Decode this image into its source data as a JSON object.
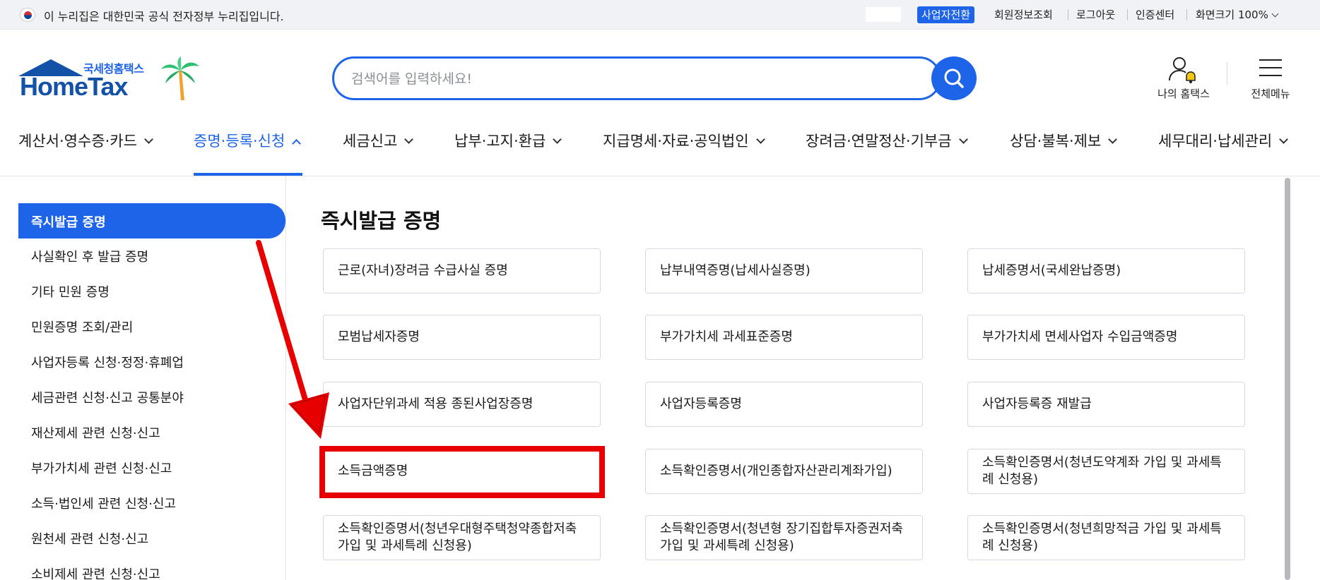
{
  "govbar": {
    "text": "이 누리집은 대한민국 공식 전자정부 누리집입니다.",
    "switch_label": "사업자전환",
    "links": [
      "회원정보조회",
      "로그아웃",
      "인증센터"
    ],
    "zoom_label": "화면크기 100%"
  },
  "header": {
    "logo_kr": "국세청홈택스",
    "logo_en": "HomeTax",
    "search_placeholder": "검색어를 입력하세요!",
    "myhome_label": "나의 홈택스",
    "allmenu_label": "전체메뉴"
  },
  "gnb": {
    "items": [
      {
        "label": "계산서·영수증·카드"
      },
      {
        "label": "증명·등록·신청"
      },
      {
        "label": "세금신고"
      },
      {
        "label": "납부·고지·환급"
      },
      {
        "label": "지급명세·자료·공익법인"
      },
      {
        "label": "장려금·연말정산·기부금"
      },
      {
        "label": "상담·불복·제보"
      },
      {
        "label": "세무대리·납세관리"
      }
    ]
  },
  "sidebar": {
    "items": [
      {
        "label": "즉시발급 증명"
      },
      {
        "label": "사실확인 후 발급 증명"
      },
      {
        "label": "기타 민원 증명"
      },
      {
        "label": "민원증명 조회/관리"
      },
      {
        "label": "사업자등록 신청·정정·휴폐업"
      },
      {
        "label": "세금관련 신청·신고 공통분야"
      },
      {
        "label": "재산제세 관련 신청·신고"
      },
      {
        "label": "부가가치세 관련 신청·신고"
      },
      {
        "label": "소득·법인세 관련 신청·신고"
      },
      {
        "label": "원천세 관련 신청·신고"
      },
      {
        "label": "소비제세 관련 신청·신고"
      }
    ]
  },
  "main": {
    "title": "즉시발급 증명",
    "cards": [
      {
        "label": "근로(자녀)장려금 수급사실 증명"
      },
      {
        "label": "납부내역증명(납세사실증명)"
      },
      {
        "label": "납세증명서(국세완납증명)"
      },
      {
        "label": "모범납세자증명"
      },
      {
        "label": "부가가치세 과세표준증명"
      },
      {
        "label": "부가가치세 면세사업자 수입금액증명"
      },
      {
        "label": "사업자단위과세 적용 종된사업장증명"
      },
      {
        "label": "사업자등록증명"
      },
      {
        "label": "사업자등록증 재발급"
      },
      {
        "label": "소득금액증명"
      },
      {
        "label": "소득확인증명서(개인종합자산관리계좌가입)"
      },
      {
        "label": "소득확인증명서(청년도약계좌 가입 및 과세특례 신청용)"
      },
      {
        "label": "소득확인증명서(청년우대형주택청약종합저축 가입 및 과세특례 신청용)"
      },
      {
        "label": "소득확인증명서(청년형 장기집합투자증권저축 가입 및 과세특례 신청용)"
      },
      {
        "label": "소득확인증명서(청년희망적금 가입 및 과세특례 신청용)"
      }
    ]
  },
  "colors": {
    "accent": "#1e64e8",
    "annotation": "#e80000"
  }
}
